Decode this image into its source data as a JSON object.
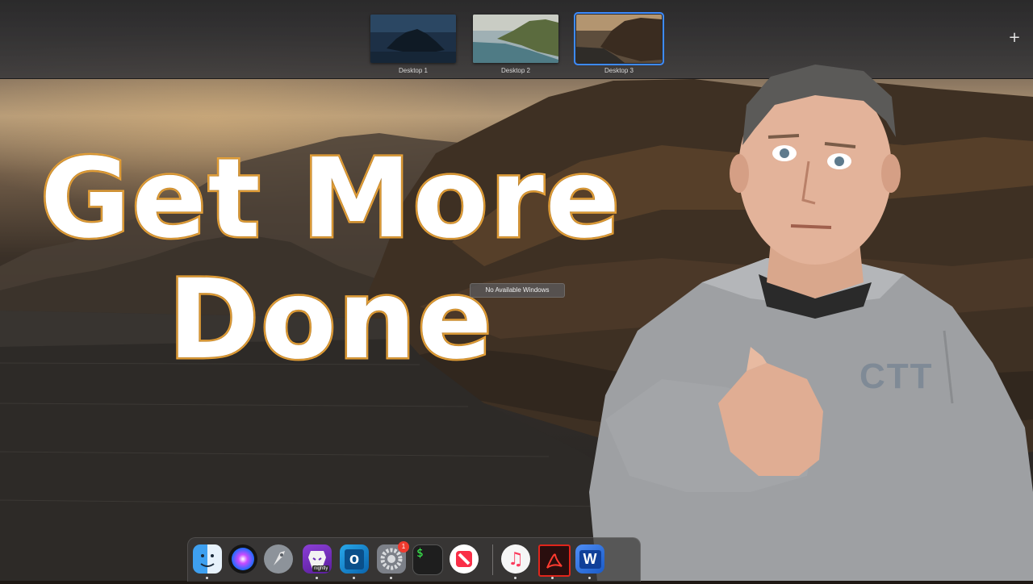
{
  "spaces": [
    {
      "label": "Desktop 1",
      "active": false
    },
    {
      "label": "Desktop 2",
      "active": false
    },
    {
      "label": "Desktop 3",
      "active": true
    }
  ],
  "add_space_label": "+",
  "headline": {
    "line1": "Get More",
    "line2": "Done"
  },
  "no_windows_label": "No Available Windows",
  "presenter": {
    "hoodie_text": "CTT"
  },
  "dock": {
    "items": [
      {
        "name": "finder",
        "icon": "finder-icon"
      },
      {
        "name": "siri",
        "icon": "siri-icon"
      },
      {
        "name": "launchpad",
        "icon": "rocket-icon"
      },
      {
        "name": "brave-nightly",
        "icon": "lion-icon",
        "tag": "nightly"
      },
      {
        "name": "outlook",
        "icon": "outlook-icon",
        "glyph": "o"
      },
      {
        "name": "system-preferences",
        "icon": "gear-icon",
        "badge": "1"
      },
      {
        "name": "terminal",
        "icon": "terminal-icon",
        "glyph": "$"
      },
      {
        "name": "news",
        "icon": "news-icon"
      },
      {
        "name": "music",
        "icon": "music-note-icon",
        "glyph": "♫"
      },
      {
        "name": "acrobat",
        "icon": "acrobat-icon"
      },
      {
        "name": "word",
        "icon": "word-icon",
        "glyph": "W"
      }
    ]
  },
  "colors": {
    "accent_outline": "#e8a238",
    "selection_blue": "#3d8bff",
    "badge_red": "#f03a2e"
  }
}
